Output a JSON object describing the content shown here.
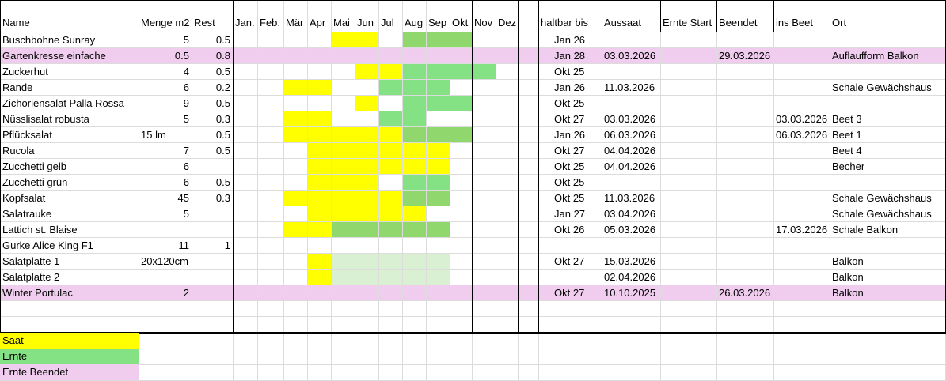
{
  "colors": {
    "saat": "#ffff00",
    "ernte": "#90d86d",
    "ernte_hell": "#84e184",
    "ernte_blass": "#d9f0d2",
    "beendet": "#f0cdee",
    "gridline": "#dcdcdc",
    "border": "#000000"
  },
  "headers": [
    "Name",
    "Menge m2",
    "Rest",
    "Jan.",
    "Feb.",
    "Mär",
    "Apr",
    "Mai",
    "Jun",
    "Jul",
    "Aug",
    "Sep",
    "Okt",
    "Nov",
    "Dez",
    "",
    "haltbar bis",
    "Aussaat",
    "Ernte Start",
    "Beendet",
    "ins Beet",
    "Ort"
  ],
  "rows": [
    {
      "name": "Buschbohne Sunray",
      "menge": "5",
      "rest": "0.5",
      "haltbar": "Jan 26",
      "aussaat": "",
      "ernte_start": "",
      "beendet": "",
      "ins_beet": "",
      "ort": "",
      "highlight": false,
      "months": {
        "Mai": "saat",
        "Jun": "saat",
        "Aug": "ernte",
        "Sep": "ernte",
        "Okt": "ernte"
      }
    },
    {
      "name": "Gartenkresse einfache",
      "menge": "0.5",
      "rest": "0.8",
      "haltbar": "Jan 28",
      "aussaat": "03.03.2026",
      "ernte_start": "",
      "beendet": "29.03.2026",
      "ins_beet": "",
      "ort": "Auflaufform  Balkon",
      "highlight": true,
      "months": {}
    },
    {
      "name": "Zuckerhut",
      "menge": "4",
      "rest": "0.5",
      "haltbar": "Okt 25",
      "aussaat": "",
      "ernte_start": "",
      "beendet": "",
      "ins_beet": "",
      "ort": "",
      "highlight": false,
      "months": {
        "Jun": "saat",
        "Jul": "saat",
        "Aug": "ernte_hell",
        "Sep": "ernte_hell",
        "Okt": "ernte_hell",
        "Nov": "ernte_hell"
      }
    },
    {
      "name": "Rande",
      "menge": "6",
      "rest": "0.2",
      "haltbar": "Jan 26",
      "aussaat": "11.03.2026",
      "ernte_start": "",
      "beendet": "",
      "ins_beet": "",
      "ort": "Schale Gewächshaus",
      "highlight": false,
      "months": {
        "Mär": "saat",
        "Apr": "saat",
        "Jul": "ernte_hell",
        "Aug": "ernte_hell",
        "Sep": "ernte_hell"
      }
    },
    {
      "name": "Zichoriensalat Palla Rossa",
      "menge": "9",
      "rest": "0.5",
      "haltbar": "Okt 25",
      "aussaat": "",
      "ernte_start": "",
      "beendet": "",
      "ins_beet": "",
      "ort": "",
      "highlight": false,
      "months": {
        "Jun": "saat",
        "Aug": "ernte_hell",
        "Sep": "ernte_hell",
        "Okt": "ernte_hell"
      }
    },
    {
      "name": "Nüsslisalat robusta",
      "menge": "5",
      "rest": "0.3",
      "haltbar": "Okt 27",
      "aussaat": "03.03.2026",
      "ernte_start": "",
      "beendet": "",
      "ins_beet": "03.03.2026",
      "ort": "Beet 3",
      "highlight": false,
      "months": {
        "Mär": "saat",
        "Apr": "saat",
        "Jul": "ernte_hell",
        "Aug": "ernte_hell"
      }
    },
    {
      "name": "Pflücksalat",
      "menge": "15 lm",
      "rest": "0.5",
      "haltbar": "Jan 26",
      "aussaat": "06.03.2026",
      "ernte_start": "",
      "beendet": "",
      "ins_beet": "06.03.2026",
      "ort": "Beet 1",
      "highlight": false,
      "months": {
        "Mär": "saat",
        "Apr": "saat",
        "Mai": "saat",
        "Jun": "saat",
        "Jul": "saat",
        "Aug": "ernte",
        "Sep": "ernte",
        "Okt": "ernte"
      }
    },
    {
      "name": "Rucola",
      "menge": "7",
      "rest": "0.5",
      "haltbar": "Okt 27",
      "aussaat": "04.04.2026",
      "ernte_start": "",
      "beendet": "",
      "ins_beet": "",
      "ort": "Beet 4",
      "highlight": false,
      "months": {
        "Apr": "saat",
        "Mai": "saat",
        "Jun": "saat",
        "Jul": "saat",
        "Aug": "saat",
        "Sep": "saat"
      }
    },
    {
      "name": "Zucchetti gelb",
      "menge": "6",
      "rest": "",
      "haltbar": "Okt 25",
      "aussaat": "04.04.2026",
      "ernte_start": "",
      "beendet": "",
      "ins_beet": "",
      "ort": "Becher",
      "highlight": false,
      "months": {
        "Apr": "saat",
        "Mai": "saat",
        "Jun": "saat",
        "Jul": "saat",
        "Aug": "saat",
        "Sep": "saat"
      }
    },
    {
      "name": "Zucchetti grün",
      "menge": "6",
      "rest": "0.5",
      "haltbar": "Okt 25",
      "aussaat": "",
      "ernte_start": "",
      "beendet": "",
      "ins_beet": "",
      "ort": "",
      "highlight": false,
      "months": {
        "Apr": "saat",
        "Mai": "saat",
        "Jun": "saat",
        "Aug": "ernte_hell",
        "Sep": "ernte_hell"
      }
    },
    {
      "name": "Kopfsalat",
      "menge": "45",
      "rest": "0.3",
      "haltbar": "Okt 25",
      "aussaat": "11.03.2026",
      "ernte_start": "",
      "beendet": "",
      "ins_beet": "",
      "ort": "Schale Gewächshaus",
      "highlight": false,
      "months": {
        "Mär": "saat",
        "Apr": "saat",
        "Mai": "saat",
        "Jun": "saat",
        "Jul": "saat",
        "Aug": "ernte",
        "Sep": "ernte"
      }
    },
    {
      "name": "Salatrauke",
      "menge": "5",
      "rest": "",
      "haltbar": "Jan 27",
      "aussaat": "03.04.2026",
      "ernte_start": "",
      "beendet": "",
      "ins_beet": "",
      "ort": "Schale Gewächshaus",
      "highlight": false,
      "months": {
        "Apr": "saat",
        "Mai": "saat",
        "Jun": "saat",
        "Jul": "saat",
        "Aug": "saat"
      }
    },
    {
      "name": "Lattich st. Blaise",
      "menge": "",
      "rest": "",
      "haltbar": "Okt 26",
      "aussaat": "05.03.2026",
      "ernte_start": "",
      "beendet": "",
      "ins_beet": "17.03.2026",
      "ort": "Schale Balkon",
      "highlight": false,
      "months": {
        "Mär": "saat",
        "Apr": "saat",
        "Mai": "ernte",
        "Jun": "ernte",
        "Jul": "ernte",
        "Aug": "ernte",
        "Sep": "ernte"
      }
    },
    {
      "name": "Gurke Alice King F1",
      "menge": "11",
      "rest": "1",
      "haltbar": "",
      "aussaat": "",
      "ernte_start": "",
      "beendet": "",
      "ins_beet": "",
      "ort": "",
      "highlight": false,
      "months": {}
    },
    {
      "name": "Salatplatte 1",
      "menge": "20x120cm",
      "rest": "",
      "haltbar": "Okt 27",
      "aussaat": "15.03.2026",
      "ernte_start": "",
      "beendet": "",
      "ins_beet": "",
      "ort": "Balkon",
      "highlight": false,
      "months": {
        "Apr": "saat",
        "Mai": "ernte_blass",
        "Jun": "ernte_blass",
        "Jul": "ernte_blass",
        "Aug": "ernte_blass",
        "Sep": "ernte_blass"
      }
    },
    {
      "name": "Salatplatte 2",
      "menge": "",
      "rest": "",
      "haltbar": "",
      "aussaat": "02.04.2026",
      "ernte_start": "",
      "beendet": "",
      "ins_beet": "",
      "ort": "Balkon",
      "highlight": false,
      "months": {
        "Apr": "saat",
        "Mai": "ernte_blass",
        "Jun": "ernte_blass",
        "Jul": "ernte_blass",
        "Aug": "ernte_blass",
        "Sep": "ernte_blass"
      }
    },
    {
      "name": "Winter Portulac",
      "menge": "2",
      "rest": "",
      "haltbar": "Okt 27",
      "aussaat": "10.10.2025",
      "ernte_start": "",
      "beendet": "26.03.2026",
      "ins_beet": "",
      "ort": "Balkon",
      "highlight": true,
      "months": {}
    }
  ],
  "legend": [
    {
      "label": "Saat",
      "color": "#ffff00"
    },
    {
      "label": "Ernte",
      "color": "#84e184"
    },
    {
      "label": "Ernte Beendet",
      "color": "#f0cdee"
    }
  ]
}
